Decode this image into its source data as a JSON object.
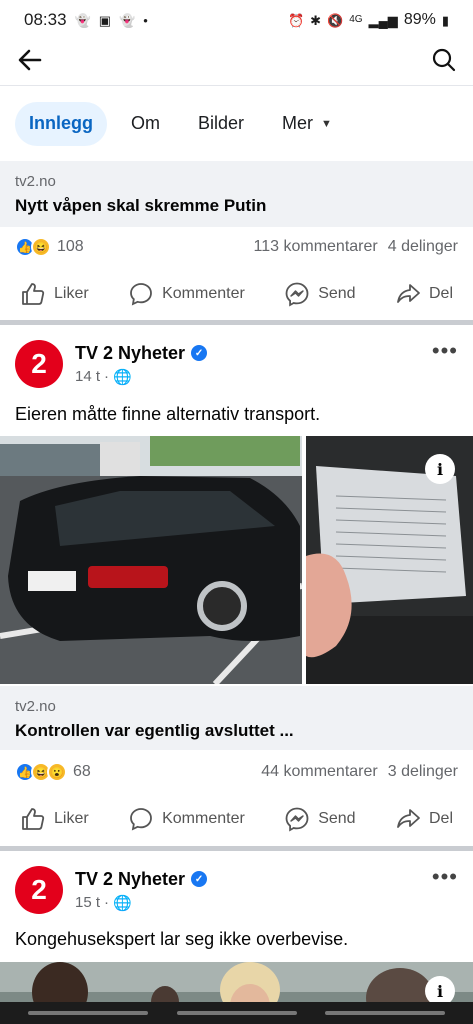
{
  "status": {
    "time": "08:33",
    "battery": "89%",
    "network": "4G"
  },
  "tabs": [
    {
      "label": "Innlegg"
    },
    {
      "label": "Om"
    },
    {
      "label": "Bilder"
    },
    {
      "label": "Mer"
    }
  ],
  "post1": {
    "link_domain": "tv2.no",
    "link_title": "Nytt våpen skal skremme Putin",
    "reactions": "108",
    "comments": "113 kommentarer",
    "shares": "4 delinger"
  },
  "post2": {
    "page_name": "TV 2 Nyheter",
    "time": "14 t",
    "text": "Eieren måtte finne alternativ transport.",
    "link_domain": "tv2.no",
    "link_title": "Kontrollen var egentlig avsluttet ...",
    "reactions": "68",
    "comments": "44 kommentarer",
    "shares": "3 delinger"
  },
  "post3": {
    "page_name": "TV 2 Nyheter",
    "time": "15 t",
    "text": "Kongehusekspert lar seg ikke overbevise."
  },
  "actions": {
    "like": "Liker",
    "comment": "Kommenter",
    "send": "Send",
    "share": "Del"
  },
  "colors": {
    "accent": "#1877f2",
    "brand": "#e3001b"
  }
}
